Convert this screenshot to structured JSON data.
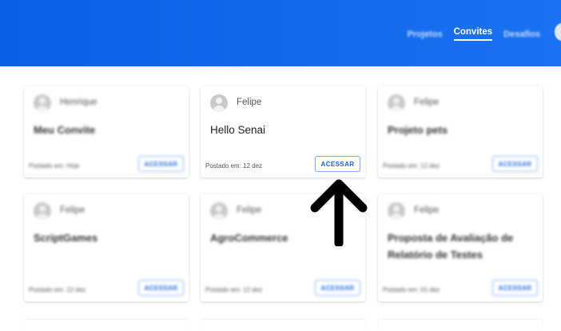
{
  "nav": {
    "items": [
      {
        "label": "Projetos",
        "active": false
      },
      {
        "label": "Convites",
        "active": true
      },
      {
        "label": "Desafios",
        "active": false
      }
    ]
  },
  "cards": [
    {
      "author": "Henrique",
      "title": "Meu Convite",
      "posted": "Postado em: Hoje",
      "button": "ACESSAR"
    },
    {
      "author": "Felipe",
      "title": "Hello Senai",
      "posted": "Postado em: 12 dez",
      "button": "ACESSAR"
    },
    {
      "author": "Felipe",
      "title": "Projeto pets",
      "posted": "Postado em: 12 dez",
      "button": "ACESSAR"
    },
    {
      "author": "Felipe",
      "title": "ScriptGames",
      "posted": "Postado em: 12 dez",
      "button": "ACESSAR"
    },
    {
      "author": "Felipe",
      "title": "AgroCommerce",
      "posted": "Postado em: 12 dez",
      "button": "ACESSAR"
    },
    {
      "author": "Felipe",
      "title": "Proposta de Avaliação de Relatório de Testes",
      "posted": "Postado em: 01 dez",
      "button": "ACESSAR"
    }
  ],
  "colors": {
    "header": "#0a5fe3",
    "accent": "#1766d8"
  }
}
